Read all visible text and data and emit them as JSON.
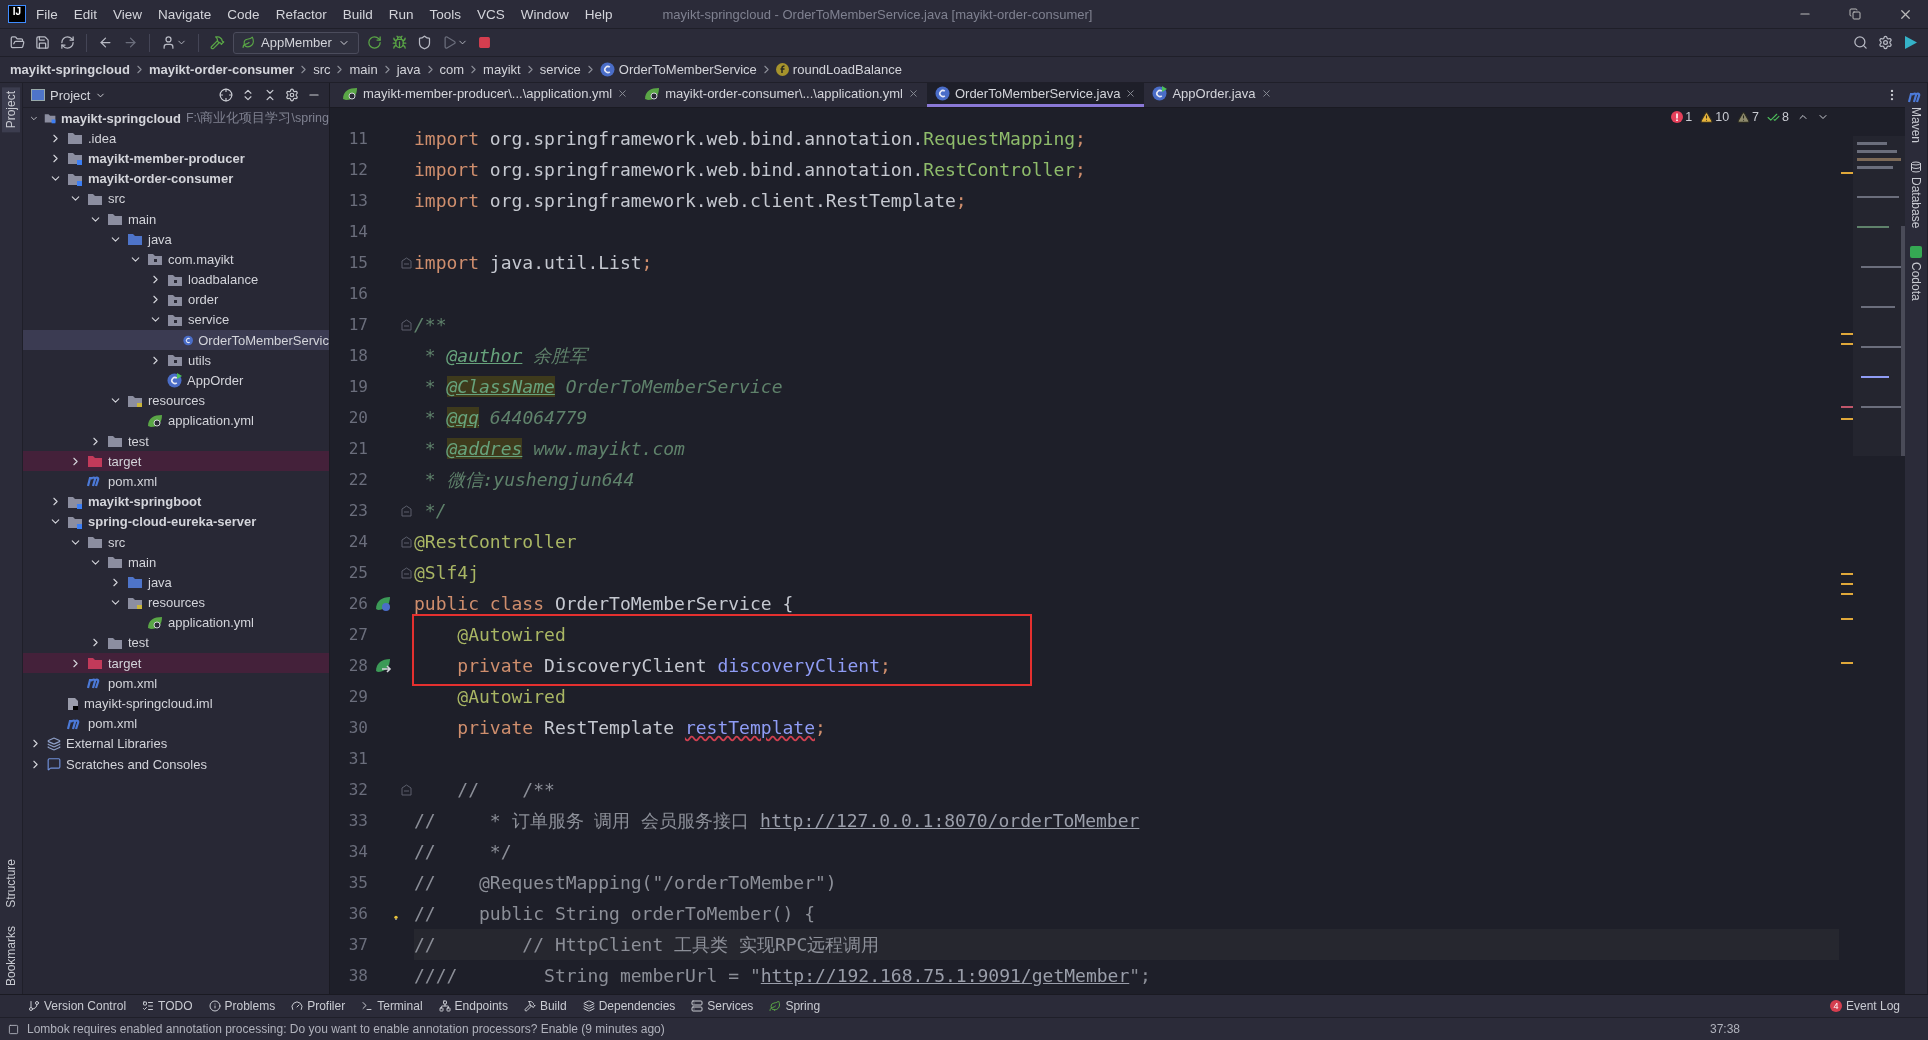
{
  "window": {
    "logo_text": "IJ",
    "title": "mayikt-springcloud - OrderToMemberService.java [mayikt-order-consumer]"
  },
  "menu": [
    "File",
    "Edit",
    "View",
    "Navigate",
    "Code",
    "Refactor",
    "Build",
    "Run",
    "Tools",
    "VCS",
    "Window",
    "Help"
  ],
  "run_config": "AppMember",
  "breadcrumbs": [
    {
      "label": "mayikt-springcloud",
      "bold": true,
      "kind": "plain"
    },
    {
      "label": "mayikt-order-consumer",
      "bold": true,
      "kind": "plain"
    },
    {
      "label": "src",
      "bold": false,
      "kind": "plain"
    },
    {
      "label": "main",
      "bold": false,
      "kind": "plain"
    },
    {
      "label": "java",
      "bold": false,
      "kind": "plain"
    },
    {
      "label": "com",
      "bold": false,
      "kind": "plain"
    },
    {
      "label": "mayikt",
      "bold": false,
      "kind": "plain"
    },
    {
      "label": "service",
      "bold": false,
      "kind": "plain"
    },
    {
      "label": "OrderToMemberService",
      "bold": false,
      "kind": "class"
    },
    {
      "label": "roundLoadBalance",
      "bold": false,
      "kind": "field"
    }
  ],
  "left_tools": [
    {
      "label": "Project",
      "selected": true
    },
    {
      "label": "Structure",
      "selected": false
    },
    {
      "label": "Bookmarks",
      "selected": false
    }
  ],
  "right_tools": [
    {
      "label": "Maven",
      "kind": "maven"
    },
    {
      "label": "Database",
      "kind": "database"
    },
    {
      "label": "Codota",
      "kind": "codota"
    }
  ],
  "project_panel": {
    "title": "Project"
  },
  "project_tree": [
    {
      "label": "mayikt-springcloud",
      "hint": "F:\\商业化项目学习\\spring",
      "kind": "module",
      "expanded": true,
      "selected": false,
      "children": [
        {
          "label": ".idea",
          "kind": "folder",
          "expanded": false,
          "selected": false
        },
        {
          "label": "mayikt-member-producer",
          "kind": "module",
          "expanded": false,
          "selected": false
        },
        {
          "label": "mayikt-order-consumer",
          "kind": "module",
          "expanded": true,
          "selected": false,
          "children": [
            {
              "label": "src",
              "kind": "folder",
              "expanded": true,
              "selected": false,
              "children": [
                {
                  "label": "main",
                  "kind": "folder",
                  "expanded": true,
                  "selected": false,
                  "children": [
                    {
                      "label": "java",
                      "kind": "source",
                      "expanded": true,
                      "selected": false,
                      "children": [
                        {
                          "label": "com.mayikt",
                          "kind": "package",
                          "expanded": true,
                          "selected": false,
                          "children": [
                            {
                              "label": "loadbalance",
                              "kind": "package",
                              "expanded": false,
                              "selected": false
                            },
                            {
                              "label": "order",
                              "kind": "package",
                              "expanded": false,
                              "selected": false
                            },
                            {
                              "label": "service",
                              "kind": "package",
                              "expanded": true,
                              "selected": false,
                              "children": [
                                {
                                  "label": "OrderToMemberServic",
                                  "kind": "class",
                                  "selected": true
                                }
                              ]
                            },
                            {
                              "label": "utils",
                              "kind": "package",
                              "expanded": false,
                              "selected": false
                            },
                            {
                              "label": "AppOrder",
                              "kind": "app",
                              "selected": false
                            }
                          ]
                        }
                      ]
                    },
                    {
                      "label": "resources",
                      "kind": "resources",
                      "expanded": true,
                      "selected": false,
                      "children": [
                        {
                          "label": "application.yml",
                          "kind": "yml",
                          "selected": false
                        }
                      ]
                    }
                  ]
                },
                {
                  "label": "test",
                  "kind": "folder",
                  "expanded": false,
                  "selected": false
                }
              ]
            },
            {
              "label": "target",
              "kind": "excluded",
              "expanded": false,
              "selected": false
            },
            {
              "label": "pom.xml",
              "kind": "maven",
              "selected": false
            }
          ]
        },
        {
          "label": "mayikt-springboot",
          "kind": "module",
          "expanded": false,
          "selected": false
        },
        {
          "label": "spring-cloud-eureka-server",
          "kind": "module",
          "expanded": true,
          "selected": false,
          "children": [
            {
              "label": "src",
              "kind": "folder",
              "expanded": true,
              "selected": false,
              "children": [
                {
                  "label": "main",
                  "kind": "folder",
                  "expanded": true,
                  "selected": false,
                  "children": [
                    {
                      "label": "java",
                      "kind": "source",
                      "expanded": false,
                      "selected": false
                    },
                    {
                      "label": "resources",
                      "kind": "resources",
                      "expanded": true,
                      "selected": false,
                      "children": [
                        {
                          "label": "application.yml",
                          "kind": "yml",
                          "selected": false
                        }
                      ]
                    }
                  ]
                },
                {
                  "label": "test",
                  "kind": "folder",
                  "expanded": false,
                  "selected": false
                }
              ]
            },
            {
              "label": "target",
              "kind": "excluded",
              "expanded": false,
              "selected": false
            },
            {
              "label": "pom.xml",
              "kind": "maven",
              "selected": false
            }
          ]
        },
        {
          "label": "mayikt-springcloud.iml",
          "kind": "iml",
          "selected": false
        },
        {
          "label": "pom.xml",
          "kind": "maven",
          "selected": false
        }
      ]
    },
    {
      "label": "External Libraries",
      "kind": "libs",
      "expanded": false,
      "selected": false
    },
    {
      "label": "Scratches and Consoles",
      "kind": "scratches",
      "expanded": false,
      "selected": false
    }
  ],
  "tabs": [
    {
      "label": "mayikt-member-producer\\...\\application.yml",
      "kind": "yml",
      "selected": false
    },
    {
      "label": "mayikt-order-consumer\\...\\application.yml",
      "kind": "yml",
      "selected": false
    },
    {
      "label": "OrderToMemberService.java",
      "kind": "class",
      "selected": true
    },
    {
      "label": "AppOrder.java",
      "kind": "app",
      "selected": false
    }
  ],
  "inspections": [
    {
      "kind": "error",
      "count": "1"
    },
    {
      "kind": "warning",
      "count": "10"
    },
    {
      "kind": "weak",
      "count": "7"
    },
    {
      "kind": "typo",
      "count": "8"
    }
  ],
  "lines": [
    {
      "number": "11",
      "tokens": [
        {
          "kind": "kw",
          "text": "import "
        },
        {
          "kind": "plain",
          "text": "org.springframework.web.bind.annotation."
        },
        {
          "kind": "type",
          "text": "RequestMapping"
        },
        {
          "kind": "kw",
          "text": ";"
        }
      ]
    },
    {
      "number": "12",
      "tokens": [
        {
          "kind": "kw",
          "text": "import "
        },
        {
          "kind": "plain",
          "text": "org.springframework.web.bind.annotation."
        },
        {
          "kind": "type",
          "text": "RestController"
        },
        {
          "kind": "kw",
          "text": ";"
        }
      ]
    },
    {
      "number": "13",
      "tokens": [
        {
          "kind": "kw",
          "text": "import "
        },
        {
          "kind": "plain",
          "text": "org.springframework.web.client.RestTemplate"
        },
        {
          "kind": "kw",
          "text": ";"
        }
      ]
    },
    {
      "number": "14"
    },
    {
      "number": "15",
      "fold": true,
      "tokens": [
        {
          "kind": "kw",
          "text": "import "
        },
        {
          "kind": "plain",
          "text": "java.util.List"
        },
        {
          "kind": "kw",
          "text": ";"
        }
      ]
    },
    {
      "number": "16"
    },
    {
      "number": "17",
      "fold": true,
      "tokens": [
        {
          "kind": "doc",
          "text": "/**"
        }
      ]
    },
    {
      "number": "18",
      "tokens": [
        {
          "kind": "doc",
          "text": " * "
        },
        {
          "kind": "doctag",
          "text": "@author"
        },
        {
          "kind": "doc",
          "text": " 余胜军"
        }
      ]
    },
    {
      "number": "19",
      "tokens": [
        {
          "kind": "doc",
          "text": " * "
        },
        {
          "kind": "tagmark",
          "text": "@ClassName"
        },
        {
          "kind": "doc",
          "text": " OrderToMemberService"
        }
      ]
    },
    {
      "number": "20",
      "tokens": [
        {
          "kind": "doc",
          "text": " * "
        },
        {
          "kind": "tagmark",
          "text": "@qq"
        },
        {
          "kind": "doc",
          "text": " 644064779"
        }
      ]
    },
    {
      "number": "21",
      "tokens": [
        {
          "kind": "doc",
          "text": " * "
        },
        {
          "kind": "tagmark",
          "text": "@addres"
        },
        {
          "kind": "doc",
          "text": " www.mayikt.com"
        }
      ]
    },
    {
      "number": "22",
      "tokens": [
        {
          "kind": "doc",
          "text": " * 微信:yushengjun644"
        }
      ]
    },
    {
      "number": "23",
      "fold": true,
      "tokens": [
        {
          "kind": "doc",
          "text": " */"
        }
      ]
    },
    {
      "number": "24",
      "fold": true,
      "tokens": [
        {
          "kind": "ann",
          "text": "@RestController"
        }
      ]
    },
    {
      "number": "25",
      "fold": true,
      "tokens": [
        {
          "kind": "ann",
          "text": "@Slf4j"
        }
      ]
    },
    {
      "number": "26",
      "marker": {
        "kind": "bean"
      },
      "tokens": [
        {
          "kind": "kw",
          "text": "public class "
        },
        {
          "kind": "plain",
          "text": "OrderToMemberService {"
        }
      ]
    },
    {
      "number": "27",
      "boxed": true,
      "tokens": [
        {
          "kind": "ann",
          "text": "    @Autowired"
        }
      ]
    },
    {
      "number": "28",
      "boxed": true,
      "marker": {
        "kind": "inject"
      },
      "tokens": [
        {
          "kind": "kw",
          "text": "    private "
        },
        {
          "kind": "plain",
          "text": "DiscoveryClient "
        },
        {
          "kind": "field",
          "text": "discoveryClient"
        },
        {
          "kind": "kw",
          "text": ";"
        }
      ]
    },
    {
      "number": "29",
      "tokens": [
        {
          "kind": "ann",
          "text": "    @Autowired"
        }
      ]
    },
    {
      "number": "30",
      "tokens": [
        {
          "kind": "kw",
          "text": "    private "
        },
        {
          "kind": "plain",
          "text": "RestTemplate "
        },
        {
          "kind": "unresolved",
          "text": "restTemplate"
        },
        {
          "kind": "kw",
          "text": ";"
        }
      ]
    },
    {
      "number": "31"
    },
    {
      "number": "32",
      "fold": true,
      "tokens": [
        {
          "kind": "comment",
          "text": "    //    /**"
        }
      ]
    },
    {
      "number": "33",
      "tokens": [
        {
          "kind": "comment",
          "text": "//     * 订单服务 调用 会员服务接口 "
        },
        {
          "kind": "link",
          "text": "http://127.0.0.1:8070/orderToMember"
        }
      ]
    },
    {
      "number": "34",
      "tokens": [
        {
          "kind": "comment",
          "text": "//     */"
        }
      ]
    },
    {
      "number": "35",
      "tokens": [
        {
          "kind": "comment",
          "text": "//    @RequestMapping(\"/orderToMember\")"
        }
      ]
    },
    {
      "number": "36",
      "marker": {
        "kind": "bulb"
      },
      "tokens": [
        {
          "kind": "comment",
          "text": "//    public String orderToMember() {"
        }
      ]
    },
    {
      "number": "37",
      "current": true,
      "tokens": [
        {
          "kind": "comment",
          "text": "//        // HttpClient 工具类 实现RPC远程调用"
        }
      ]
    },
    {
      "number": "38",
      "tokens": [
        {
          "kind": "comment",
          "text": "////        String memberUrl = \""
        },
        {
          "kind": "link",
          "text": "http://192.168.75.1:9091/getMember"
        },
        {
          "kind": "comment",
          "text": "\";"
        }
      ]
    }
  ],
  "tool_bar": [
    {
      "label": "Version Control",
      "kind": "branch"
    },
    {
      "label": "TODO",
      "kind": "list"
    },
    {
      "label": "Problems",
      "kind": "info"
    },
    {
      "label": "Profiler",
      "kind": "gauge"
    },
    {
      "label": "Terminal",
      "kind": "terminal"
    },
    {
      "label": "Endpoints",
      "kind": "endpoints"
    },
    {
      "label": "Build",
      "kind": "hammer"
    },
    {
      "label": "Dependencies",
      "kind": "layers"
    },
    {
      "label": "Services",
      "kind": "services"
    },
    {
      "label": "Spring",
      "kind": "leaf"
    }
  ],
  "event_log": {
    "label": "Event Log",
    "badge": "4"
  },
  "status_bar": {
    "message": "Lombok requires enabled annotation processing: Do you want to enable annotation processors? Enable (9 minutes ago)",
    "position": "37:38"
  }
}
